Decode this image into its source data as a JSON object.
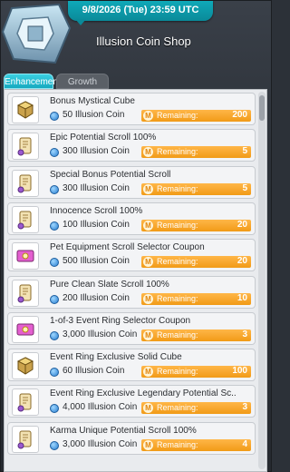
{
  "header": {
    "date_text": "9/8/2026 (Tue) 23:59 UTC",
    "title": "Illusion Coin Shop"
  },
  "tabs": [
    {
      "label": "Enhancement",
      "active": true
    },
    {
      "label": "Growth",
      "active": false
    }
  ],
  "remaining_label": "Remaining:",
  "colors": {
    "accent": "#16a9bf",
    "remaining_pill": "#f19b17",
    "coin": "#2a7fd1"
  },
  "items": [
    {
      "name": "Bonus Mystical Cube",
      "price": "50 Illusion Coin",
      "remaining": "200",
      "icon": "cube-icon"
    },
    {
      "name": "Epic Potential Scroll 100%",
      "price": "300 Illusion Coin",
      "remaining": "5",
      "icon": "scroll-icon"
    },
    {
      "name": "Special Bonus Potential Scroll",
      "price": "300 Illusion Coin",
      "remaining": "5",
      "icon": "scroll-icon"
    },
    {
      "name": "Innocence Scroll 100%",
      "price": "100 Illusion Coin",
      "remaining": "20",
      "icon": "scroll-icon"
    },
    {
      "name": "Pet Equipment Scroll Selector Coupon",
      "price": "500 Illusion Coin",
      "remaining": "20",
      "icon": "coupon-icon"
    },
    {
      "name": "Pure Clean Slate Scroll 100%",
      "price": "200 Illusion Coin",
      "remaining": "10",
      "icon": "scroll-icon"
    },
    {
      "name": "1-of-3 Event Ring Selector Coupon",
      "price": "3,000 Illusion Coin",
      "remaining": "3",
      "icon": "coupon-icon"
    },
    {
      "name": "Event Ring Exclusive Solid Cube",
      "price": "60 Illusion Coin",
      "remaining": "100",
      "icon": "cube-icon"
    },
    {
      "name": "Event Ring Exclusive Legendary Potential Sc..",
      "price": "4,000 Illusion Coin",
      "remaining": "3",
      "icon": "scroll-icon"
    },
    {
      "name": "Karma Unique Potential Scroll 100%",
      "price": "3,000 Illusion Coin",
      "remaining": "4",
      "icon": "scroll-icon"
    }
  ]
}
